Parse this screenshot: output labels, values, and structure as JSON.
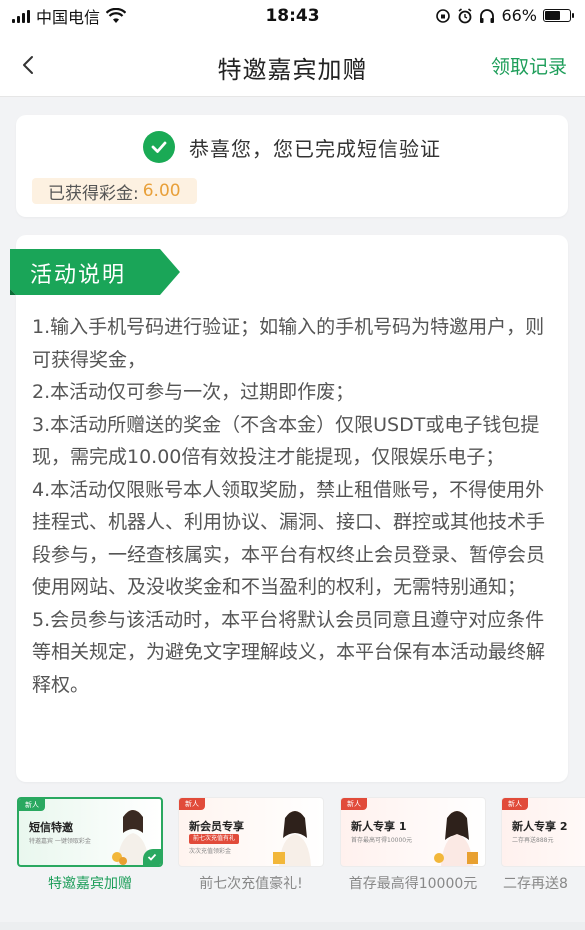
{
  "status_bar": {
    "carrier": "中国电信",
    "time": "18:43",
    "battery": "66%",
    "battery_level": 0.66
  },
  "nav": {
    "title": "特邀嘉宾加赠",
    "right_link": "领取记录"
  },
  "success": {
    "message": "恭喜您，您已完成短信验证",
    "bonus_label": "已获得彩金:",
    "bonus_value": "6.00"
  },
  "rules": {
    "heading": "活动说明",
    "items": [
      "1.输入手机号码进行验证；如输入的手机号码为特邀用户，则可获得奖金，",
      "2.本活动仅可参与一次，过期即作废；",
      "3.本活动所赠送的奖金（不含本金）仅限USDT或电子钱包提现，需完成10.00倍有效投注才能提现，仅限娱乐电子；",
      "4.本活动仅限账号本人领取奖励，禁止租借账号，不得使用外挂程式、机器人、利用协议、漏洞、接口、群控或其他技术手段参与，一经查核属实，本平台有权终止会员登录、暂停会员使用网站、及没收奖金和不当盈利的权利，无需特别通知；",
      "5.会员参与该活动时，本平台将默认会员同意且遵守对应条件等相关规定，为避免文字理解歧义，本平台保有本活动最终解释权。"
    ]
  },
  "tabs": [
    {
      "label": "特邀嘉宾加赠",
      "banner_tag": "新人",
      "banner_title": "短信特邀",
      "banner_sub": "特邀嘉宾 一键领取彩金",
      "banner_pill": "",
      "active": true,
      "tag_color": "#2aa860"
    },
    {
      "label": "前七次充值豪礼!",
      "banner_tag": "新人",
      "banner_title": "新会员专享",
      "banner_sub": "次次充值领彩金",
      "banner_pill": "前七次充值有礼",
      "active": false,
      "tag_color": "#e14b3a"
    },
    {
      "label": "首存最高得10000元",
      "banner_tag": "新人",
      "banner_title": "新人专享 1",
      "banner_sub": "首存最高可得10000元",
      "banner_pill": "",
      "active": false,
      "tag_color": "#e14b3a"
    },
    {
      "label": "二存再送8",
      "banner_tag": "新人",
      "banner_title": "新人专享 2",
      "banner_sub": "二存再送888元",
      "banner_pill": "",
      "active": false,
      "tag_color": "#e14b3a"
    }
  ],
  "colors": {
    "brand_green": "#1e9e5a",
    "bonus_orange": "#e8a03a",
    "check_green": "#1aaa55"
  },
  "icons": [
    "signal-icon",
    "wifi-icon",
    "back-chevron-icon",
    "check-circle-icon",
    "lock-rotation-icon",
    "alarm-icon",
    "headphones-icon",
    "battery-icon"
  ]
}
